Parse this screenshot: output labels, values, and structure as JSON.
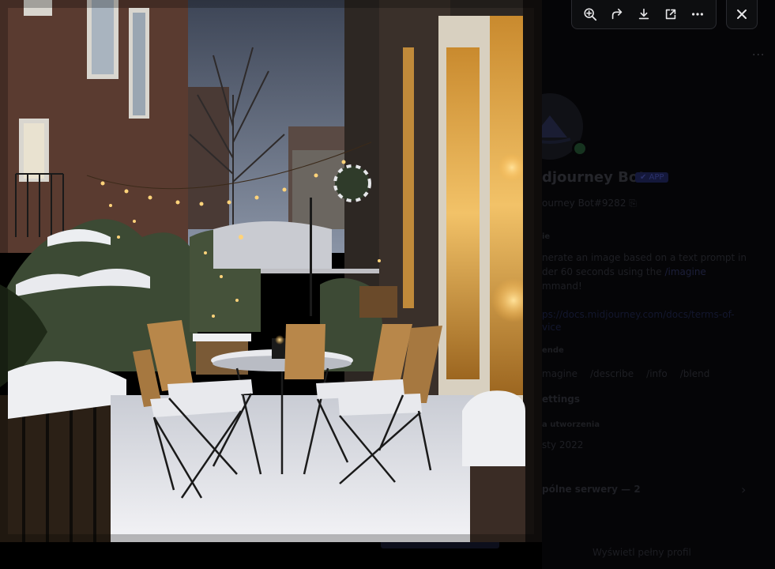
{
  "profile": {
    "name": "djourney Bot",
    "app_badge": "✔ APP",
    "tag": "ourney Bot#9282",
    "tag_suffix": "⎘",
    "about_heading": "ie",
    "about_line1": "nerate an image based on a text prompt in",
    "about_line2_prefix": "der 60 seconds using the",
    "about_cmd": "/imagine",
    "about_line3": "mmand!",
    "link_text": "ps://docs.midjourney.com/docs/terms-of-vice",
    "commands_heading": "ende",
    "commands": [
      "magine",
      "/describe",
      "/info",
      "/blend"
    ],
    "settings": "ettings",
    "created_heading": "a utworzenia",
    "created_date": "sty 2022",
    "mutual_servers": "pólne serwery — 2",
    "full_profile": "Wyświetl pełny profil",
    "more_dots": "···",
    "chevron": "›"
  },
  "toolbar": {
    "buttons": [
      {
        "name": "zoom-in",
        "icon": "magnifier-plus-icon"
      },
      {
        "name": "forward",
        "icon": "share-arrow-icon"
      },
      {
        "name": "download",
        "icon": "download-icon"
      },
      {
        "name": "open-in-browser",
        "icon": "external-link-icon"
      },
      {
        "name": "more",
        "icon": "ellipsis-icon"
      }
    ],
    "close_icon": "close-x-icon"
  },
  "colors": {
    "icon": "#e6e6e8",
    "toolbar_bg": "#0d0e10",
    "accent_dim": "#2b316a",
    "light_glow": "#ffd37a"
  },
  "bg_letter": "e"
}
